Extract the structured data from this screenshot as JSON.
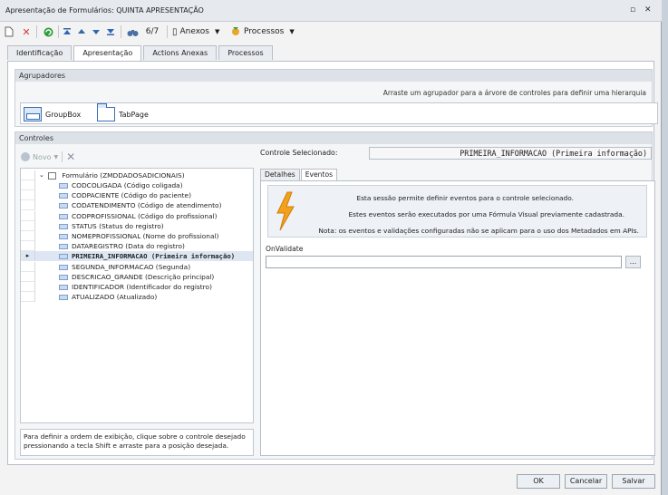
{
  "window": {
    "title": "Apresentação de Formulários: QUINTA APRESENTAÇÃO",
    "restore_glyph": "▫",
    "close_glyph": "✕"
  },
  "toolbar": {
    "record_counter": "6/7",
    "anexos_label": "Anexos",
    "processos_label": "Processos"
  },
  "tabs": [
    "Identificação",
    "Apresentação",
    "Actions Anexas",
    "Processos"
  ],
  "agrupadores": {
    "title": "Agrupadores",
    "hint": "Arraste um agrupador para a árvore de controles para definir uma hierarquia",
    "items": [
      "GroupBox",
      "TabPage"
    ]
  },
  "controles": {
    "title": "Controles",
    "novo_label": "Novo",
    "selected_label": "Controle Selecionado:",
    "selected_value": "PRIMEIRA_INFORMACAO (Primeira informação)",
    "tree_root": "Formulário (ZMDDADOSADICIONAIS)",
    "tree_items": [
      "CODCOLIGADA (Código coligada)",
      "CODPACIENTE (Código do paciente)",
      "CODATENDIMENTO (Código de atendimento)",
      "CODPROFISSIONAL (Código do profissional)",
      "STATUS (Status do registro)",
      "NOMEPROFISSIONAL (Nome do profissional)",
      "DATAREGISTRO (Data do registro)",
      "PRIMEIRA_INFORMACAO (Primeira informação)",
      "SEGUNDA_INFORMACAO (Segunda)",
      "DESCRICAO_GRANDE (Descrição principal)",
      "IDENTIFICADOR (Identificador do registro)",
      "ATUALIZADO (Atualizado)"
    ],
    "info_line1": "Para definir a ordem de exibição, clique sobre o controle desejado",
    "info_line2": "pressionando a tecla Shift e arraste para a posição desejada."
  },
  "detail_tabs": [
    "Detalhes",
    "Eventos"
  ],
  "eventos": {
    "line1": "Esta sessão permite definir eventos para o controle selecionado.",
    "line2": "Estes eventos serão executados por uma Fórmula Visual previamente cadastrada.",
    "line3": "Nota: os eventos e validações configuradas não se aplicam para o uso dos Metadados em APIs.",
    "onvalidate_label": "OnValidate",
    "onvalidate_value": "",
    "ellipsis": "..."
  },
  "footer": {
    "ok": "OK",
    "cancel": "Cancelar",
    "save": "Salvar"
  },
  "colors": {
    "accent": "#3b6fb6",
    "bolt": "#f2a21a",
    "selection": "#dde6f2"
  }
}
